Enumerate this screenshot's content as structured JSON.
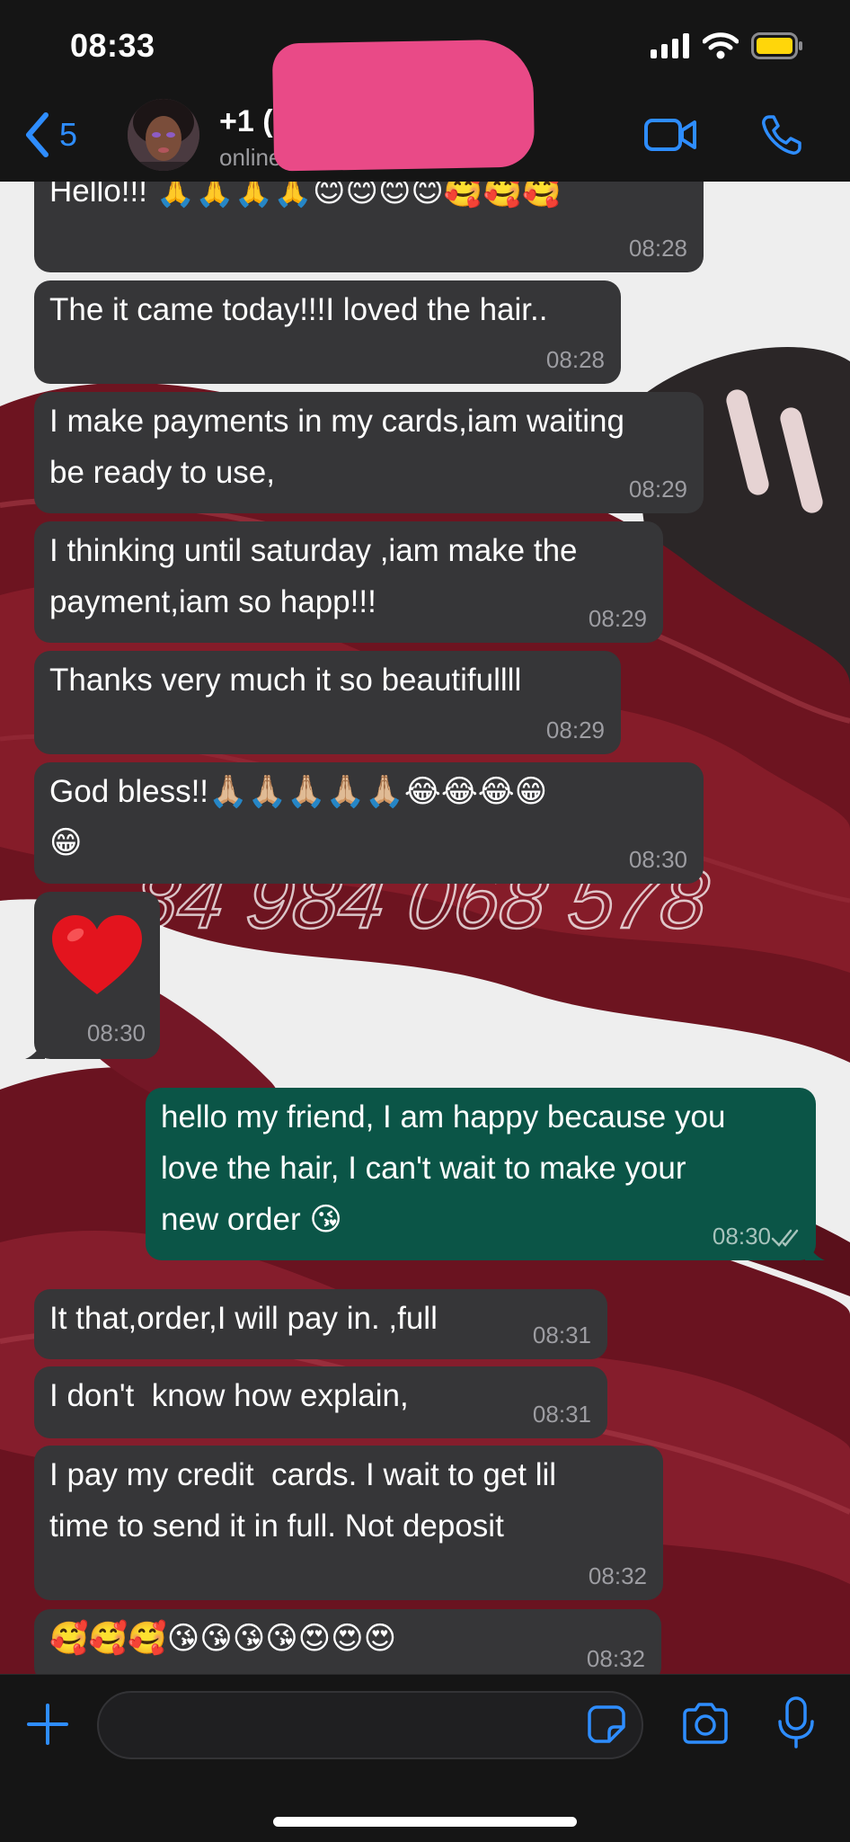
{
  "status_bar": {
    "time": "08:33"
  },
  "header": {
    "back_count": "5",
    "contact_name": "+1 (5",
    "contact_status": "online"
  },
  "wallpaper_watermark": "84 984 068 578",
  "messages": [
    {
      "direction": "in",
      "text": "Hello!!! 🙏🙏🙏🙏😊😊😊😊🥰🥰🥰",
      "time": "08:28"
    },
    {
      "direction": "in",
      "text": "The it came today!!!I loved the hair..",
      "time": "08:28"
    },
    {
      "direction": "in",
      "text": "I make payments in my cards,iam waiting\nbe ready to use,",
      "time": "08:29"
    },
    {
      "direction": "in",
      "text": "I thinking until saturday ,iam make the\npayment,iam so happ!!!",
      "time": "08:29"
    },
    {
      "direction": "in",
      "text": "Thanks very much it so beautifullll",
      "time": "08:29"
    },
    {
      "direction": "in",
      "text": "God bless!!🙏🏼🙏🏼🙏🏼🙏🏼🙏🏼😂😂😂😁\n😁",
      "time": "08:30"
    },
    {
      "direction": "in",
      "text": "❤️",
      "time": "08:30"
    },
    {
      "direction": "out",
      "text": "hello my friend, I am happy because you\nlove the hair, I can't wait to make your\nnew order 😘",
      "time": "08:30",
      "status": "read"
    },
    {
      "direction": "in",
      "text": "It that,order,I will pay in. ,full",
      "time": "08:31"
    },
    {
      "direction": "in",
      "text": "I don't  know how explain,",
      "time": "08:31"
    },
    {
      "direction": "in",
      "text": "I pay my credit  cards. I wait to get lil\ntime to send it in full. Not deposit",
      "time": "08:32"
    },
    {
      "direction": "in",
      "text": "🥰🥰🥰😘😘😘😘😍😍😍",
      "time": "08:32"
    }
  ],
  "composer": {
    "input_value": ""
  },
  "icons": {
    "back": "chevron-left-icon",
    "video": "video-camera-icon",
    "call": "phone-icon",
    "add": "plus-icon",
    "sticker": "sticker-icon",
    "camera": "camera-icon",
    "mic": "microphone-icon"
  },
  "colors": {
    "accent": "#2e8dff",
    "incoming_bubble": "#363638",
    "outgoing_bubble": "#0b5547",
    "bar_background": "#151515",
    "redaction": "#e94a87"
  }
}
